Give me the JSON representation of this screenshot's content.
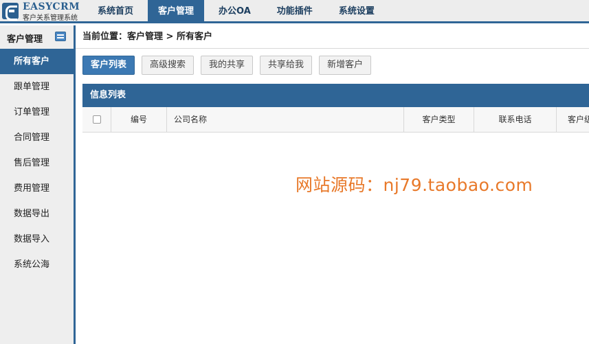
{
  "app": {
    "logo_name": "EASYCRM",
    "logo_subtitle": "客户关系管理系统"
  },
  "nav": {
    "items": [
      {
        "label": "系统首页",
        "active": false
      },
      {
        "label": "客户管理",
        "active": true
      },
      {
        "label": "办公OA",
        "active": false
      },
      {
        "label": "功能插件",
        "active": false
      },
      {
        "label": "系统设置",
        "active": false
      }
    ]
  },
  "sidebar": {
    "title": "客户管理",
    "items": [
      {
        "label": "所有客户",
        "active": true
      },
      {
        "label": "跟单管理",
        "active": false
      },
      {
        "label": "订单管理",
        "active": false
      },
      {
        "label": "合同管理",
        "active": false
      },
      {
        "label": "售后管理",
        "active": false
      },
      {
        "label": "费用管理",
        "active": false
      },
      {
        "label": "数据导出",
        "active": false
      },
      {
        "label": "数据导入",
        "active": false
      },
      {
        "label": "系统公海",
        "active": false
      }
    ]
  },
  "breadcrumb": {
    "text": "当前位置：客户管理 > 所有客户"
  },
  "toolbar": {
    "buttons": [
      {
        "label": "客户列表",
        "primary": true
      },
      {
        "label": "高级搜索",
        "primary": false
      },
      {
        "label": "我的共享",
        "primary": false
      },
      {
        "label": "共享给我",
        "primary": false
      },
      {
        "label": "新增客户",
        "primary": false
      }
    ]
  },
  "panel": {
    "title": "信息列表"
  },
  "table": {
    "columns": [
      "编号",
      "公司名称",
      "客户类型",
      "联系电话",
      "客户级"
    ]
  },
  "watermark": {
    "text": "网站源码：nj79.taobao.com"
  },
  "colors": {
    "accent": "#2f6596",
    "watermark": "#e8792a"
  }
}
